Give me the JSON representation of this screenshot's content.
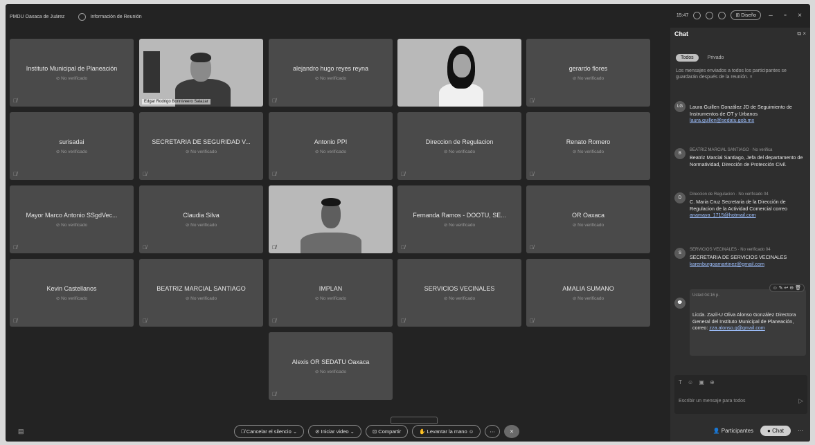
{
  "titlebar": {
    "meeting_name": "PMDU Oaxaca de Juárez",
    "info_label": "Información de Reunión",
    "time": "15:47",
    "layout_label": "Diseño"
  },
  "tiles": [
    {
      "name": "Instituto Municipal de Planeación",
      "status": "No verificado"
    },
    {
      "name": "Edgar Rodrigo Bonniveero Salazar",
      "video": "office"
    },
    {
      "name": "alejandro hugo reyes reyna",
      "status": "No verificado"
    },
    {
      "name": "",
      "video": "dark"
    },
    {
      "name": "gerardo flores",
      "status": "No verificado"
    },
    {
      "name": "surisadai",
      "status": "No verificado"
    },
    {
      "name": "SECRETARIA DE SEGURIDAD V...",
      "status": "No verificado"
    },
    {
      "name": "Antonio PPI",
      "status": "No verificado"
    },
    {
      "name": "Direccion de Regulacion",
      "status": "No verificado"
    },
    {
      "name": "Renato Romero",
      "status": "No verificado"
    },
    {
      "name": "Mayor Marco Antonio SSgdVec...",
      "status": "No verificado"
    },
    {
      "name": "Claudia Silva",
      "status": "No verificado"
    },
    {
      "name": "",
      "video": "blinds"
    },
    {
      "name": "Fernanda Ramos - DOOTU, SE...",
      "status": "No verificado"
    },
    {
      "name": "OR Oaxaca",
      "status": "No verificado"
    },
    {
      "name": "Kevin Castellanos",
      "status": "No verificado"
    },
    {
      "name": "BEATRIZ MARCIAL SANTIAGO",
      "status": "No verificado"
    },
    {
      "name": "IMPLAN",
      "status": "No verificado"
    },
    {
      "name": "SERVICIOS VECINALES",
      "status": "No verificado"
    },
    {
      "name": "AMALIA SUMANO",
      "status": "No verificado"
    },
    {
      "name": "Alexis OR SEDATU Oaxaca",
      "status": "No verificado"
    }
  ],
  "chat": {
    "title": "Chat",
    "tab_all": "Todos",
    "tab_private": "Privado",
    "notice": "Los mensajes enviados a todos los participantes se guardarán después de la reunión.",
    "messages": [
      {
        "avatar": "LG",
        "meta": "",
        "body": "Laura Guillen González JD de Seguimiento de Instrumentos de OT y Urbanos",
        "link": "laura.guillen@sedatu.gob.mx"
      },
      {
        "avatar": "B",
        "meta": "BEATRIZ MARCIAL SANTIAGO · No verifica",
        "body": "Beatriz Marcial Santiago, Jefa del departamento de Normatividad, Dirección de Protección Civil.",
        "link": ""
      },
      {
        "avatar": "D",
        "meta": "Direccion de Regulacion · No verificado 04",
        "body": "C. Maria Cruz Secretaria de la Dirección de Regulacion de la Actividad Comercial correo",
        "link": "anamaya_1715@hotmail.com"
      },
      {
        "avatar": "S",
        "meta": "SERVICIOS VECINALES · No verificado 04",
        "body": "SECRETARIA DE SERVICIOS VECINALES",
        "link": "karenburgoamartinez@gmail.com"
      },
      {
        "avatar": "",
        "meta": "Usted 04:16 p.",
        "body": "Licda. Zazil-U Oliva Alonso González Directora General del Instituto Municipal de Planeación, correo:",
        "link": "zza.alonso.g@gmail.com"
      }
    ],
    "hover_tools": "☺ ✎ ↩ ⊖ 🗑",
    "composer_placeholder": "Escribir un mensaje para todos"
  },
  "bottombar": {
    "mute": "Cancelar el silencio",
    "video": "Iniciar video",
    "share": "Compartir",
    "raise_hand": "Levantar la mano",
    "participants": "Participantes",
    "chat": "Chat"
  }
}
